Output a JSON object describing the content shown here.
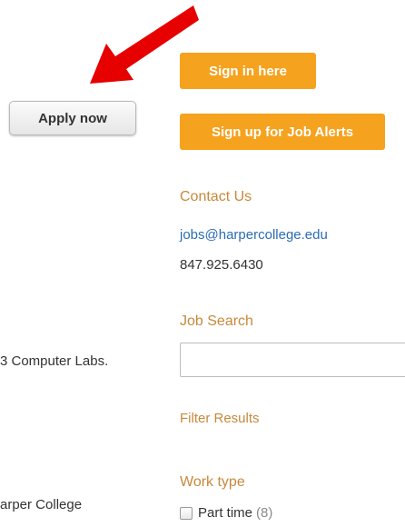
{
  "apply": {
    "label": "Apply now"
  },
  "signin": {
    "label": "Sign in here"
  },
  "signup": {
    "label": "Sign up for Job Alerts"
  },
  "contact": {
    "heading": "Contact Us",
    "email": "jobs@harpercollege.edu",
    "phone": "847.925.6430"
  },
  "job_search": {
    "heading": "Job Search",
    "value": "",
    "placeholder": ""
  },
  "filter": {
    "heading": "Filter Results"
  },
  "work_type": {
    "heading": "Work type",
    "options": [
      {
        "label": "Part time",
        "count": "(8)",
        "checked": false
      }
    ]
  },
  "left_column": {
    "line1": "3 Computer Labs.",
    "line2": "arper College"
  },
  "annotation": {
    "arrow_color": "#e60000",
    "icon": "red-arrow-icon"
  },
  "colors": {
    "accent": "#f5a21e",
    "heading": "#c8893b",
    "link": "#2a6db3"
  }
}
